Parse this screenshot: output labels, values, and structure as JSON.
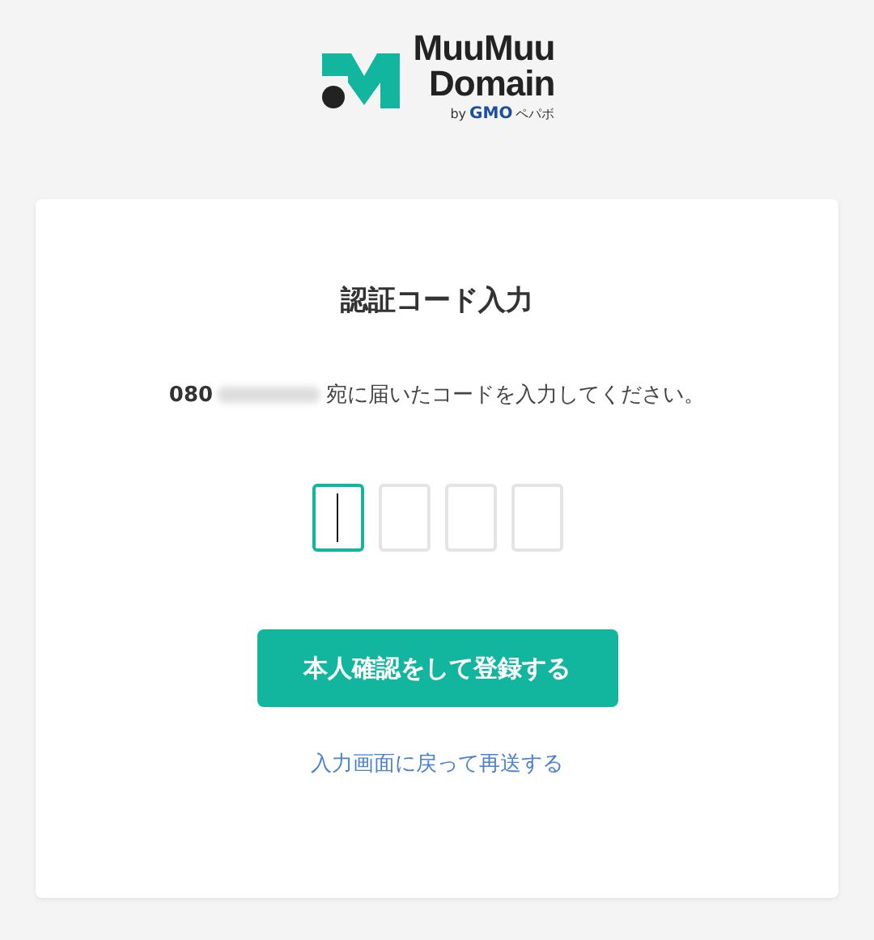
{
  "logo": {
    "lines": [
      "MuuMuu",
      "Domain"
    ],
    "by": "by",
    "maker": "GMO",
    "maker_suffix": "ペパボ"
  },
  "card": {
    "title": "認証コード入力",
    "message": {
      "number_prefix": "080",
      "text": "宛に届いたコードを入力してください。"
    },
    "code_boxes": [
      {
        "focused": true
      },
      {
        "focused": false
      },
      {
        "focused": false
      },
      {
        "focused": false
      }
    ],
    "submit": "本人確認をして登録する",
    "link": "入力画面に戻って再送する"
  }
}
